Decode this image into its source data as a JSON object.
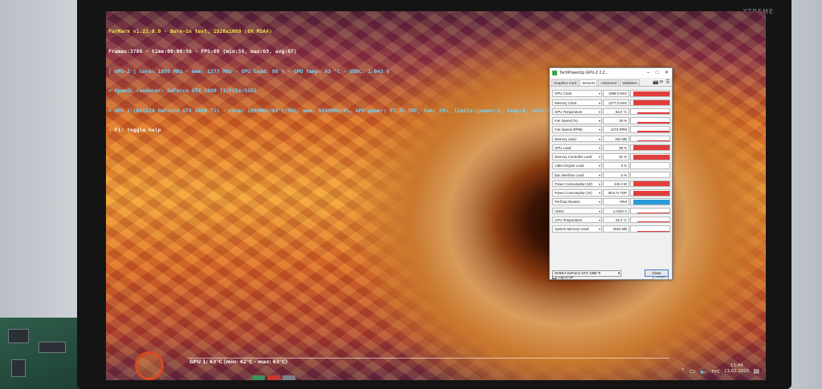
{
  "monitor": {
    "brand": "XTREME"
  },
  "furmark": {
    "lines": [
      {
        "text": "FurMark v1.21.0.0 - Burn-in test, 1920x1080 (0X MSAA)",
        "style": "title"
      },
      {
        "text": "Frames:3786 - time:00:00:56 - FPS:69 (min:58, max:69, avg:67)",
        "style": "white"
      },
      {
        "text": "[ GPU-Z ] core: 1898 MHz - mem: 1377 MHz - GPU load: 98 % - GPU temp: 63 °C - VDDC: 1.043 V",
        "style": "cyan"
      },
      {
        "text": "> OpenGL renderer: GeForce GTX 1080 Ti/PCIe/SSE2",
        "style": "cyan"
      },
      {
        "text": "> GPU 1 (NVIDIA GeForce GTX 1080 Ti) - core: 1898MHz/63°C/98%, mem: 5508MHz/4%, GPU power: 97.3% TDP, fan: 29%, limits:[power:1, temp:0, volt:0, OV:0]",
        "style": "cyan"
      },
      {
        "text": "- F1: toggle help",
        "style": "white"
      }
    ],
    "graph_label": "GPU 1: 63°C (min: 42°C - max: 63°C)"
  },
  "gpuz": {
    "title": "TechPowerUp GPU-Z 2.2...",
    "window_buttons": {
      "minimize": "–",
      "maximize": "□",
      "close": "✕"
    },
    "tabs": [
      {
        "label": "Graphics Card",
        "active": false
      },
      {
        "label": "Sensors",
        "active": true
      },
      {
        "label": "Advanced",
        "active": false
      },
      {
        "label": "Validation",
        "active": false
      }
    ],
    "tools": [
      "📷",
      "⟳",
      "☰"
    ],
    "sensors": [
      {
        "name": "GPU Clock",
        "value": "1898.0 MHz",
        "level": 0.9,
        "color": "#e23d3d"
      },
      {
        "name": "Memory Clock",
        "value": "1377.0 MHz",
        "level": 0.9,
        "color": "#e23d3d"
      },
      {
        "name": "GPU Temperature",
        "value": "63.0 °C",
        "level": 0.35,
        "color": "#e23d3d"
      },
      {
        "name": "Fan Speed (%)",
        "value": "29 %",
        "level": 0.2,
        "color": "#e23d3d"
      },
      {
        "name": "Fan Speed (RPM)",
        "value": "1073 RPM",
        "level": 0.25,
        "color": "#e23d3d"
      },
      {
        "name": "Memory Used",
        "value": "462 MB",
        "level": 0.1,
        "color": "#e23d3d"
      },
      {
        "name": "GPU Load",
        "value": "98 %",
        "level": 0.95,
        "color": "#e23d3d"
      },
      {
        "name": "Memory Controller Load",
        "value": "81 %",
        "level": 0.8,
        "color": "#e23d3d"
      },
      {
        "name": "Video Engine Load",
        "value": "0 %",
        "level": 0.0,
        "color": "#e23d3d"
      },
      {
        "name": "Bus Interface Load",
        "value": "0 %",
        "level": 0.0,
        "color": "#e23d3d"
      },
      {
        "name": "Power Consumption (W)",
        "value": "240.4 W",
        "level": 0.85,
        "color": "#e23d3d"
      },
      {
        "name": "Power Consumption (%)",
        "value": "99.5 % TDP",
        "level": 0.85,
        "color": "#e23d3d"
      },
      {
        "name": "PerfCap Reason",
        "value": "VRel",
        "level": 0.9,
        "color": "#2b9ad8"
      },
      {
        "name": "VDDC",
        "value": "1.0430 V",
        "level": 0.15,
        "color": "#e23d3d"
      },
      {
        "name": "CPU Temperature",
        "value": "43.0 °C",
        "level": 0.15,
        "color": "#e23d3d"
      },
      {
        "name": "System Memory Used",
        "value": "2554 MB",
        "level": 0.15,
        "color": "#e23d3d"
      }
    ],
    "log_label": "Log to file",
    "reset_label": "Reset",
    "device_select": "NVIDIA GeForce GTX 1080 Ti",
    "close_label": "Close"
  },
  "taskbar": {
    "language": "РУС",
    "time": "13:44",
    "date": "13.02.2020",
    "pins": [
      {
        "color": "#3f8f5a"
      },
      {
        "color": "#c8372d"
      },
      {
        "color": "#7a7f88"
      }
    ]
  }
}
